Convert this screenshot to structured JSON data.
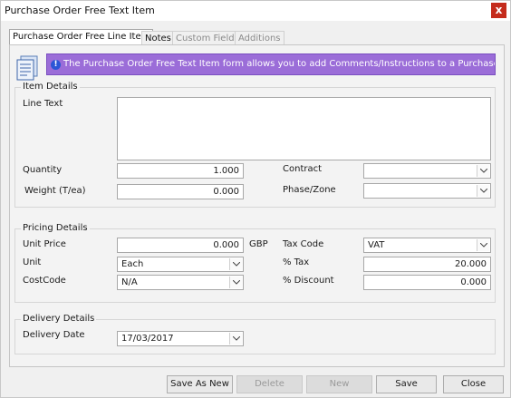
{
  "window": {
    "title": "Purchase Order Free Text Item",
    "close_label": "x"
  },
  "tabs": [
    {
      "label": "Purchase Order Free Line Item"
    },
    {
      "label": "Notes"
    },
    {
      "label": "Custom Fields"
    },
    {
      "label": "Additions"
    }
  ],
  "info": {
    "text": "The Purchase Order Free Text Item form allows you to add Comments/Instructions to a Purchase Order.",
    "icon_glyph": "!"
  },
  "item_details": {
    "title": "Item Details",
    "line_text_label": "Line Text",
    "line_text_value": "",
    "quantity_label": "Quantity",
    "quantity_value": "1.000",
    "weight_label": "Weight (T/ea)",
    "weight_value": "0.000",
    "contract_label": "Contract",
    "contract_value": "",
    "phase_label": "Phase/Zone",
    "phase_value": ""
  },
  "pricing_details": {
    "title": "Pricing Details",
    "unit_price_label": "Unit Price",
    "unit_price_value": "0.000",
    "currency": "GBP",
    "unit_label": "Unit",
    "unit_value": "Each",
    "cost_code_label": "CostCode",
    "cost_code_value": "N/A",
    "tax_code_label": "Tax Code",
    "tax_code_value": "VAT",
    "tax_pct_label": "% Tax",
    "tax_pct_value": "20.000",
    "discount_label": "% Discount",
    "discount_value": "0.000"
  },
  "delivery_details": {
    "title": "Delivery Details",
    "date_label": "Delivery Date",
    "date_value": "17/03/2017"
  },
  "buttons": {
    "save_as_new": "Save As New",
    "delete": "Delete",
    "new": "New",
    "save": "Save",
    "close": "Close"
  },
  "colors": {
    "info_bg": "#9b6dd8",
    "close_bg": "#c42b1c",
    "info_icon": "#2b56d6"
  }
}
